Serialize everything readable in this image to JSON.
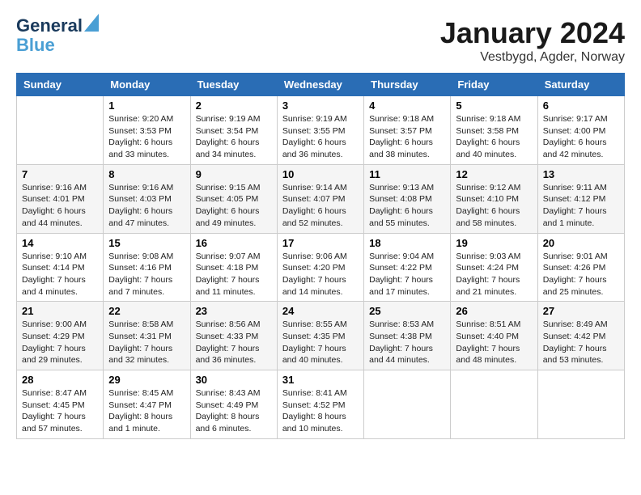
{
  "header": {
    "logo_line1": "General",
    "logo_line2": "Blue",
    "month": "January 2024",
    "location": "Vestbygd, Agder, Norway"
  },
  "days_of_week": [
    "Sunday",
    "Monday",
    "Tuesday",
    "Wednesday",
    "Thursday",
    "Friday",
    "Saturday"
  ],
  "weeks": [
    [
      {
        "day": "",
        "info": ""
      },
      {
        "day": "1",
        "info": "Sunrise: 9:20 AM\nSunset: 3:53 PM\nDaylight: 6 hours\nand 33 minutes."
      },
      {
        "day": "2",
        "info": "Sunrise: 9:19 AM\nSunset: 3:54 PM\nDaylight: 6 hours\nand 34 minutes."
      },
      {
        "day": "3",
        "info": "Sunrise: 9:19 AM\nSunset: 3:55 PM\nDaylight: 6 hours\nand 36 minutes."
      },
      {
        "day": "4",
        "info": "Sunrise: 9:18 AM\nSunset: 3:57 PM\nDaylight: 6 hours\nand 38 minutes."
      },
      {
        "day": "5",
        "info": "Sunrise: 9:18 AM\nSunset: 3:58 PM\nDaylight: 6 hours\nand 40 minutes."
      },
      {
        "day": "6",
        "info": "Sunrise: 9:17 AM\nSunset: 4:00 PM\nDaylight: 6 hours\nand 42 minutes."
      }
    ],
    [
      {
        "day": "7",
        "info": "Sunrise: 9:16 AM\nSunset: 4:01 PM\nDaylight: 6 hours\nand 44 minutes."
      },
      {
        "day": "8",
        "info": "Sunrise: 9:16 AM\nSunset: 4:03 PM\nDaylight: 6 hours\nand 47 minutes."
      },
      {
        "day": "9",
        "info": "Sunrise: 9:15 AM\nSunset: 4:05 PM\nDaylight: 6 hours\nand 49 minutes."
      },
      {
        "day": "10",
        "info": "Sunrise: 9:14 AM\nSunset: 4:07 PM\nDaylight: 6 hours\nand 52 minutes."
      },
      {
        "day": "11",
        "info": "Sunrise: 9:13 AM\nSunset: 4:08 PM\nDaylight: 6 hours\nand 55 minutes."
      },
      {
        "day": "12",
        "info": "Sunrise: 9:12 AM\nSunset: 4:10 PM\nDaylight: 6 hours\nand 58 minutes."
      },
      {
        "day": "13",
        "info": "Sunrise: 9:11 AM\nSunset: 4:12 PM\nDaylight: 7 hours\nand 1 minute."
      }
    ],
    [
      {
        "day": "14",
        "info": "Sunrise: 9:10 AM\nSunset: 4:14 PM\nDaylight: 7 hours\nand 4 minutes."
      },
      {
        "day": "15",
        "info": "Sunrise: 9:08 AM\nSunset: 4:16 PM\nDaylight: 7 hours\nand 7 minutes."
      },
      {
        "day": "16",
        "info": "Sunrise: 9:07 AM\nSunset: 4:18 PM\nDaylight: 7 hours\nand 11 minutes."
      },
      {
        "day": "17",
        "info": "Sunrise: 9:06 AM\nSunset: 4:20 PM\nDaylight: 7 hours\nand 14 minutes."
      },
      {
        "day": "18",
        "info": "Sunrise: 9:04 AM\nSunset: 4:22 PM\nDaylight: 7 hours\nand 17 minutes."
      },
      {
        "day": "19",
        "info": "Sunrise: 9:03 AM\nSunset: 4:24 PM\nDaylight: 7 hours\nand 21 minutes."
      },
      {
        "day": "20",
        "info": "Sunrise: 9:01 AM\nSunset: 4:26 PM\nDaylight: 7 hours\nand 25 minutes."
      }
    ],
    [
      {
        "day": "21",
        "info": "Sunrise: 9:00 AM\nSunset: 4:29 PM\nDaylight: 7 hours\nand 29 minutes."
      },
      {
        "day": "22",
        "info": "Sunrise: 8:58 AM\nSunset: 4:31 PM\nDaylight: 7 hours\nand 32 minutes."
      },
      {
        "day": "23",
        "info": "Sunrise: 8:56 AM\nSunset: 4:33 PM\nDaylight: 7 hours\nand 36 minutes."
      },
      {
        "day": "24",
        "info": "Sunrise: 8:55 AM\nSunset: 4:35 PM\nDaylight: 7 hours\nand 40 minutes."
      },
      {
        "day": "25",
        "info": "Sunrise: 8:53 AM\nSunset: 4:38 PM\nDaylight: 7 hours\nand 44 minutes."
      },
      {
        "day": "26",
        "info": "Sunrise: 8:51 AM\nSunset: 4:40 PM\nDaylight: 7 hours\nand 48 minutes."
      },
      {
        "day": "27",
        "info": "Sunrise: 8:49 AM\nSunset: 4:42 PM\nDaylight: 7 hours\nand 53 minutes."
      }
    ],
    [
      {
        "day": "28",
        "info": "Sunrise: 8:47 AM\nSunset: 4:45 PM\nDaylight: 7 hours\nand 57 minutes."
      },
      {
        "day": "29",
        "info": "Sunrise: 8:45 AM\nSunset: 4:47 PM\nDaylight: 8 hours\nand 1 minute."
      },
      {
        "day": "30",
        "info": "Sunrise: 8:43 AM\nSunset: 4:49 PM\nDaylight: 8 hours\nand 6 minutes."
      },
      {
        "day": "31",
        "info": "Sunrise: 8:41 AM\nSunset: 4:52 PM\nDaylight: 8 hours\nand 10 minutes."
      },
      {
        "day": "",
        "info": ""
      },
      {
        "day": "",
        "info": ""
      },
      {
        "day": "",
        "info": ""
      }
    ]
  ]
}
